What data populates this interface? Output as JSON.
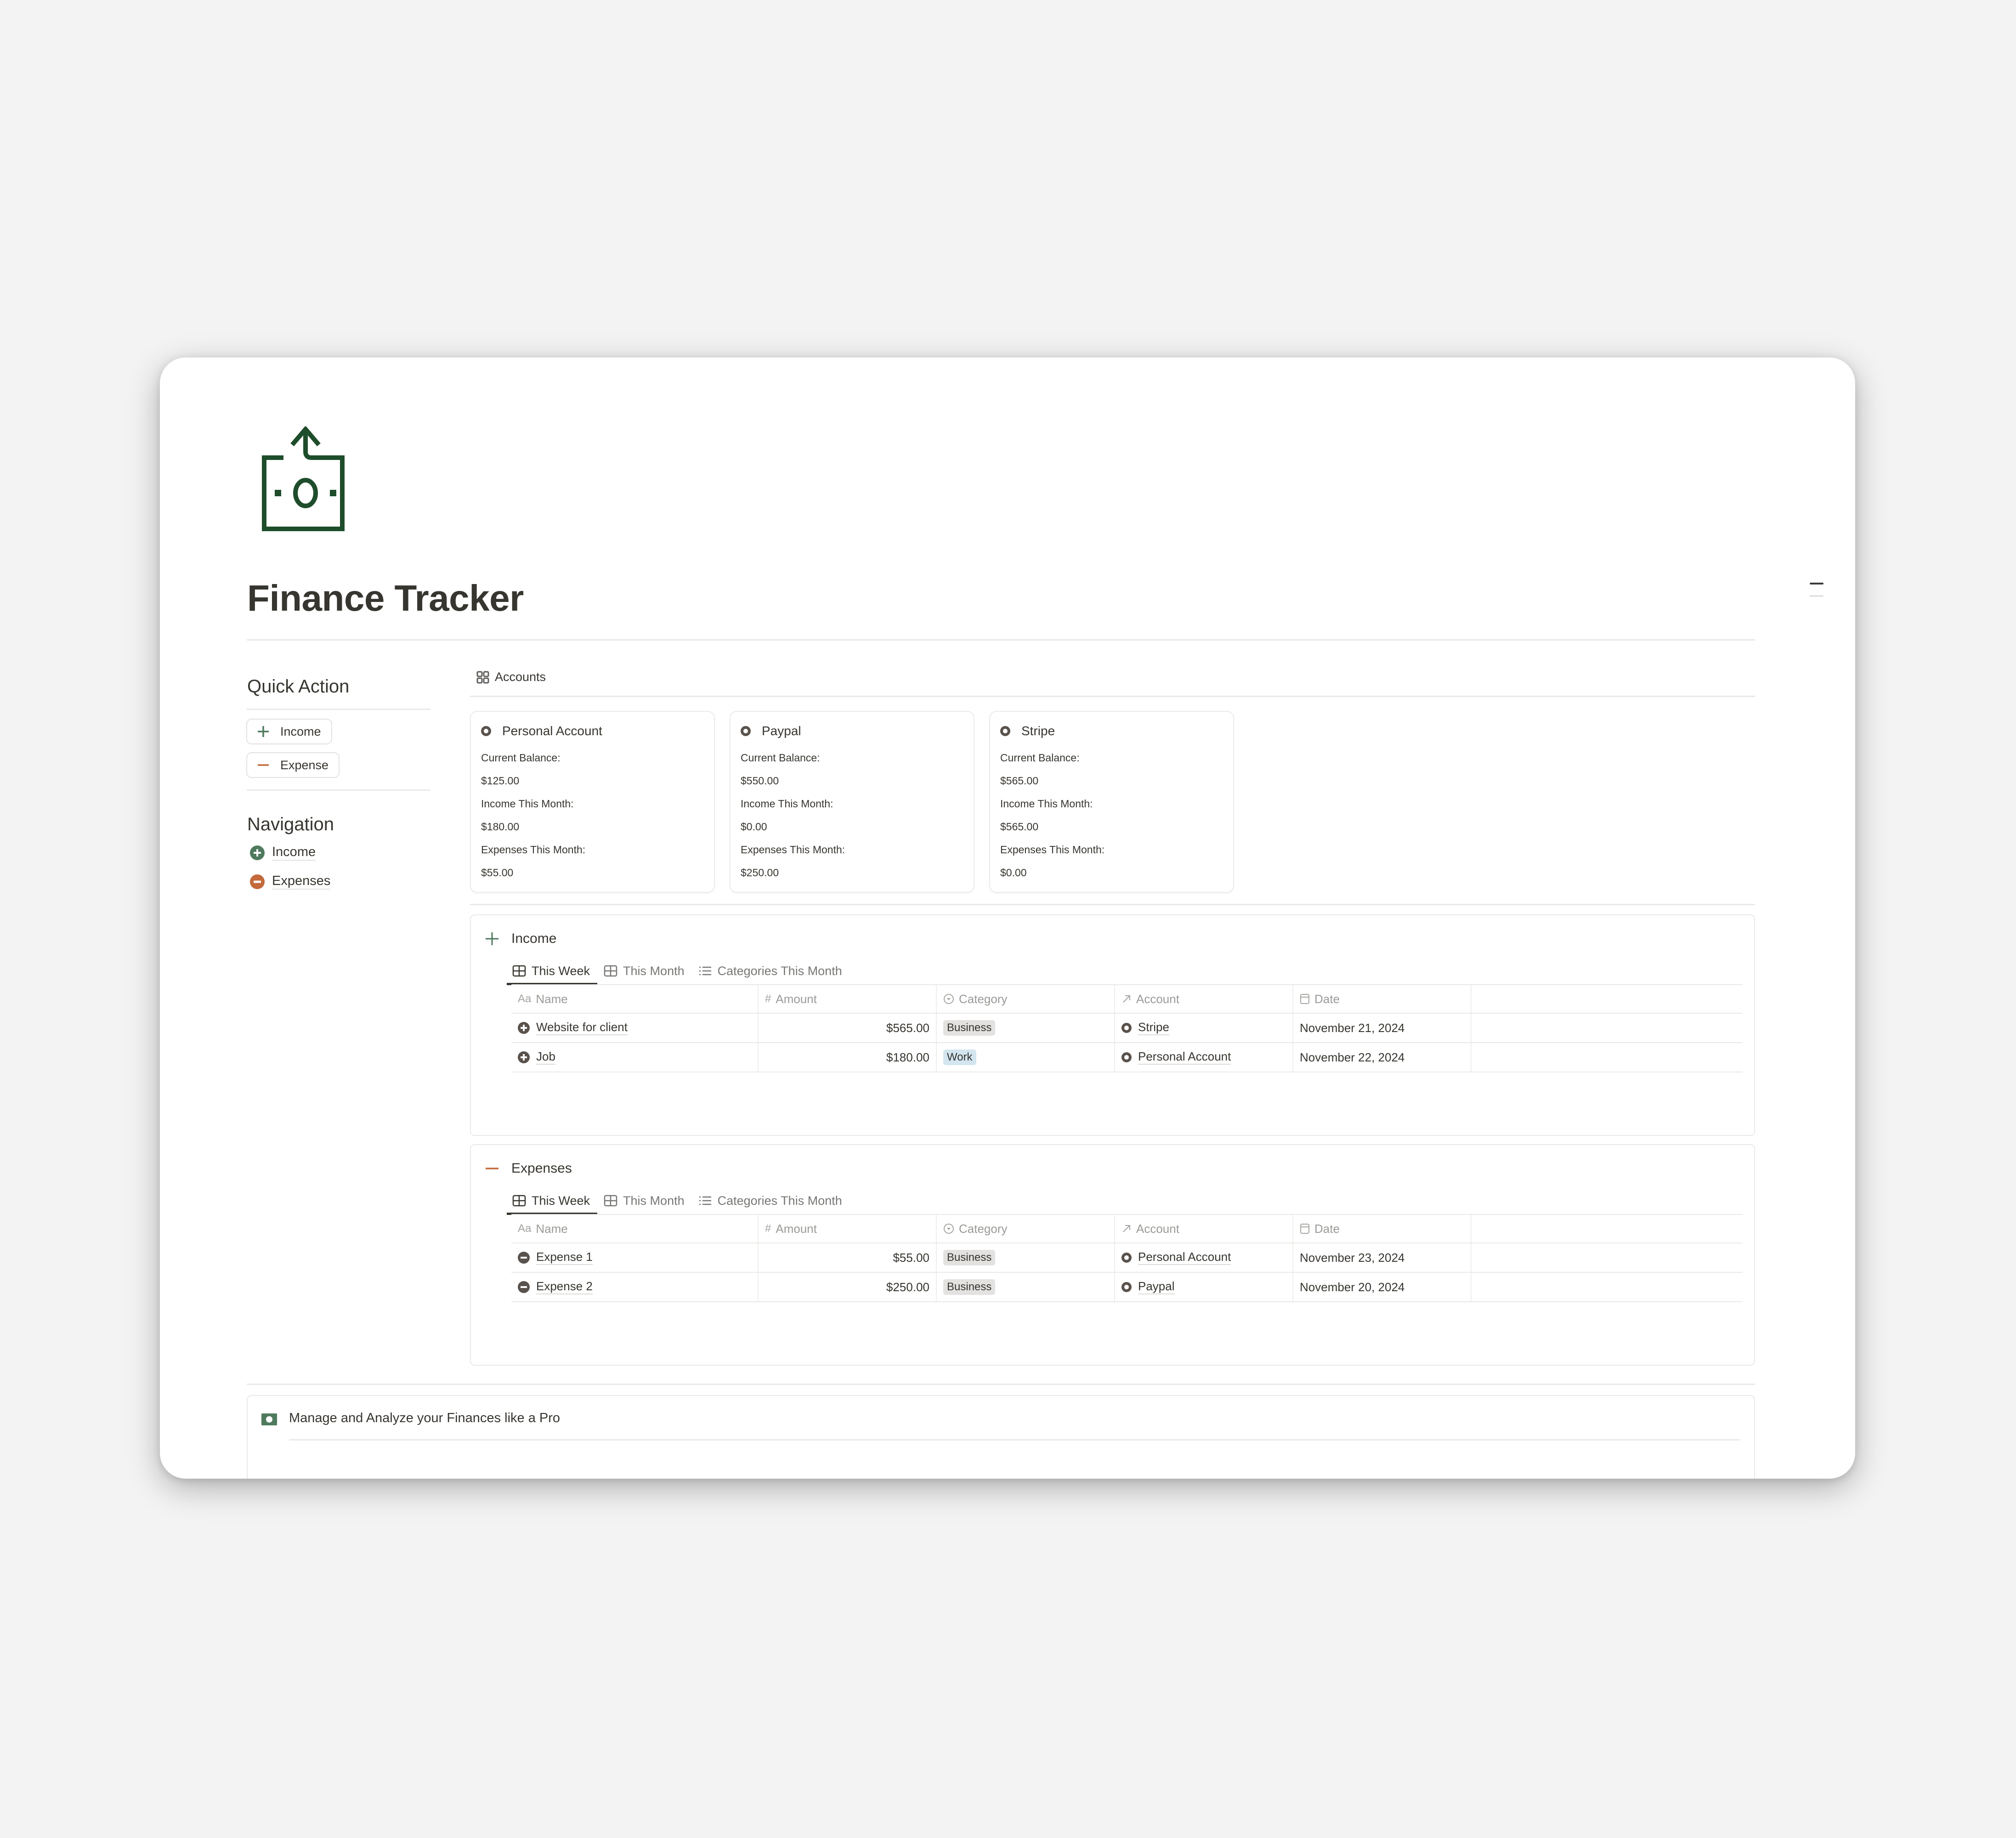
{
  "page": {
    "title": "Finance Tracker",
    "icon": "money-upload-icon",
    "brand_color": "#1e4d2b"
  },
  "sidebar": {
    "quick_action_heading": "Quick Action",
    "buttons": [
      {
        "label": "Income",
        "icon": "plus-icon",
        "color": "#4f7a5e"
      },
      {
        "label": "Expense",
        "icon": "minus-icon",
        "color": "#c4693a"
      }
    ],
    "navigation_heading": "Navigation",
    "nav_items": [
      {
        "label": "Income",
        "icon": "plus-circle-icon",
        "color": "#4f7a5e"
      },
      {
        "label": "Expenses",
        "icon": "minus-circle-icon",
        "color": "#c4693a"
      }
    ]
  },
  "accounts": {
    "view_label": "Accounts",
    "cards": [
      {
        "name": "Personal Account",
        "balance_label": "Current Balance:",
        "balance": "$125.00",
        "income_label": "Income This Month:",
        "income": "$180.00",
        "expenses_label": "Expenses This Month:",
        "expenses": "$55.00"
      },
      {
        "name": "Paypal",
        "balance_label": "Current Balance:",
        "balance": "$550.00",
        "income_label": "Income This Month:",
        "income": "$0.00",
        "expenses_label": "Expenses This Month:",
        "expenses": "$250.00"
      },
      {
        "name": "Stripe",
        "balance_label": "Current Balance:",
        "balance": "$565.00",
        "income_label": "Income This Month:",
        "income": "$565.00",
        "expenses_label": "Expenses This Month:",
        "expenses": "$0.00"
      }
    ]
  },
  "income": {
    "title": "Income",
    "tabs": [
      "This Week",
      "This Month",
      "Categories This Month"
    ],
    "active_tab": "This Week",
    "columns": [
      "Name",
      "Amount",
      "Category",
      "Account",
      "Date"
    ],
    "rows": [
      {
        "name": "Website for client",
        "amount": "$565.00",
        "category": "Business",
        "account": "Stripe",
        "date": "November 21, 2024"
      },
      {
        "name": "Job",
        "amount": "$180.00",
        "category": "Work",
        "account": "Personal Account",
        "date": "November 22, 2024"
      }
    ]
  },
  "expenses": {
    "title": "Expenses",
    "tabs": [
      "This Week",
      "This Month",
      "Categories This Month"
    ],
    "active_tab": "This Week",
    "columns": [
      "Name",
      "Amount",
      "Category",
      "Account",
      "Date"
    ],
    "rows": [
      {
        "name": "Expense 1",
        "amount": "$55.00",
        "category": "Business",
        "account": "Personal Account",
        "date": "November 23, 2024"
      },
      {
        "name": "Expense 2",
        "amount": "$250.00",
        "category": "Business",
        "account": "Paypal",
        "date": "November 20, 2024"
      }
    ]
  },
  "callout": {
    "text": "Manage and Analyze your Finances like a Pro"
  },
  "colors": {
    "income_accent": "#4f7a5e",
    "expense_accent": "#c4693a",
    "income_label": "#3f5d6b",
    "pill_gray": "#e3e2e0",
    "pill_blue": "#d3e5ef"
  }
}
